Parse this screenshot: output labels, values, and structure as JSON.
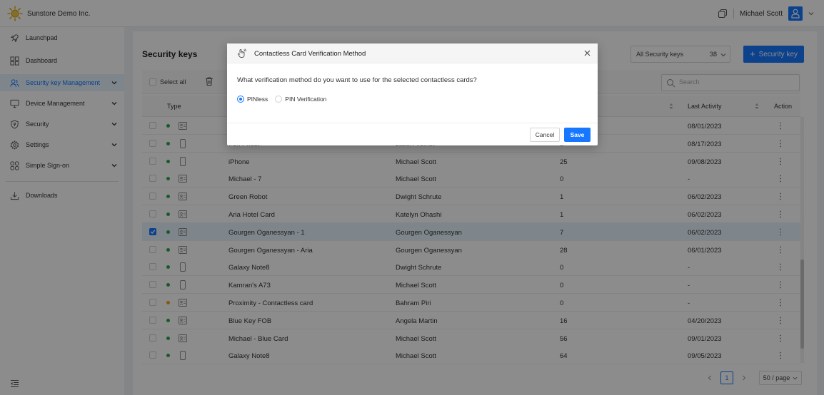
{
  "header": {
    "brand_name": "Sunstore Demo Inc.",
    "user_name": "Michael Scott"
  },
  "sidebar": {
    "items": [
      {
        "label": "Launchpad",
        "icon": "rocket-icon"
      },
      {
        "label": "Dashboard",
        "icon": "dashboard-icon"
      },
      {
        "label": "Security key Management",
        "icon": "users-icon",
        "active": true
      },
      {
        "label": "Device Management",
        "icon": "monitor-icon"
      },
      {
        "label": "Security",
        "icon": "shield-icon"
      },
      {
        "label": "Settings",
        "icon": "gear-icon"
      },
      {
        "label": "Simple Sign-on",
        "icon": "apps-icon"
      },
      {
        "label": "Downloads",
        "icon": "download-icon"
      }
    ]
  },
  "main": {
    "title": "Security keys",
    "filter": {
      "label": "All Security keys",
      "count": "38"
    },
    "add_button": "Security key",
    "select_all": "Select all",
    "search_placeholder": "Search",
    "columns": {
      "type": "Type",
      "last_activity": "Last Activity",
      "action": "Action"
    },
    "rows": [
      {
        "name": "",
        "owner": "",
        "count": "",
        "last": "08/01/2023",
        "device": "card",
        "status": "green"
      },
      {
        "name": "Iron Priest",
        "owner": "Jason Veinot",
        "count": "5",
        "last": "08/17/2023",
        "device": "phone",
        "status": "green"
      },
      {
        "name": "iPhone",
        "owner": "Michael Scott",
        "count": "25",
        "last": "09/08/2023",
        "device": "phone",
        "status": "green"
      },
      {
        "name": "Michael - 7",
        "owner": "Michael Scott",
        "count": "0",
        "last": "-",
        "device": "card",
        "status": "green"
      },
      {
        "name": "Green Robot",
        "owner": "Dwight Schrute",
        "count": "1",
        "last": "06/02/2023",
        "device": "card",
        "status": "green"
      },
      {
        "name": "Aria Hotel Card",
        "owner": "Katelyn Ohashi",
        "count": "1",
        "last": "06/02/2023",
        "device": "card",
        "status": "green"
      },
      {
        "name": "Gourgen Oganessyan - 1",
        "owner": "Gourgen Oganessyan",
        "count": "7",
        "last": "06/02/2023",
        "device": "card",
        "status": "green",
        "selected": true
      },
      {
        "name": "Gourgen Oganessyan - Aria",
        "owner": "Gourgen Oganessyan",
        "count": "28",
        "last": "06/01/2023",
        "device": "card",
        "status": "green"
      },
      {
        "name": "Galaxy Note8",
        "owner": "Dwight Schrute",
        "count": "0",
        "last": "-",
        "device": "phone",
        "status": "green"
      },
      {
        "name": "Kamran's A73",
        "owner": "Michael Scott",
        "count": "0",
        "last": "-",
        "device": "phone",
        "status": "green"
      },
      {
        "name": "Proximity - Contactless card",
        "owner": "Bahram Piri",
        "count": "0",
        "last": "-",
        "device": "card",
        "status": "orange"
      },
      {
        "name": "Blue Key FOB",
        "owner": "Angela Martin",
        "count": "16",
        "last": "04/20/2023",
        "device": "card",
        "status": "green"
      },
      {
        "name": "Michael - Blue Card",
        "owner": "Michael Scott",
        "count": "56",
        "last": "09/01/2023",
        "device": "card",
        "status": "green"
      },
      {
        "name": "Galaxy Note8",
        "owner": "Michael Scott",
        "count": "64",
        "last": "09/05/2023",
        "device": "phone",
        "status": "green"
      }
    ],
    "pagination": {
      "page": "1",
      "page_size": "50 / page"
    }
  },
  "modal": {
    "title": "Contactless Card Verification Method",
    "question": "What verification method do you want to use for the selected contactless cards?",
    "options": [
      {
        "label": "PINless",
        "selected": true
      },
      {
        "label": "PIN Verification",
        "selected": false
      }
    ],
    "cancel_label": "Cancel",
    "save_label": "Save"
  },
  "colors": {
    "accent": "#1677ff",
    "status_green": "#2da44e",
    "status_orange": "#f0a020",
    "brand_yellow": "#e0b020"
  }
}
